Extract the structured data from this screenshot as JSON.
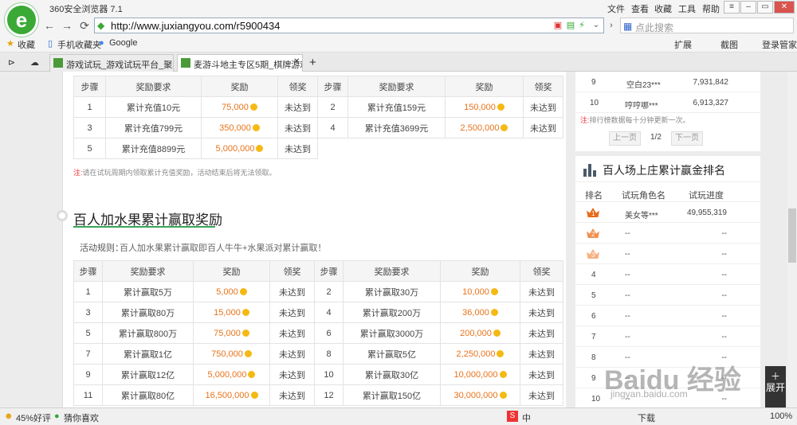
{
  "browser": {
    "app_title": "360安全浏览器 7.1",
    "menu": [
      "文件",
      "查看",
      "收藏",
      "工具",
      "帮助"
    ],
    "url": "http://www.juxiangyou.com/r5900434",
    "search_placeholder": "点此搜索",
    "toolbar": {
      "expand": "扩展",
      "screenshot": "截图",
      "login": "登录管家"
    },
    "bookmarks": [
      "收藏",
      "手机收藏夹",
      "Google"
    ],
    "tabs": [
      {
        "label": "游戏试玩_游戏试玩平台_聚享游",
        "active": false
      },
      {
        "label": "麦游斗地主专区5期_棋牌游戏",
        "active": true
      }
    ],
    "status": {
      "rating": "45%好评",
      "guess": "猜你喜欢",
      "download": "下载",
      "zoom": "100%",
      "ime": "中"
    }
  },
  "recharge_table": {
    "headers": [
      "步骤",
      "奖励要求",
      "奖励",
      "领奖",
      "步骤",
      "奖励要求",
      "奖励",
      "领奖"
    ],
    "rows": [
      [
        {
          "step": "1",
          "req": "累计充值10元",
          "reward": "75,000",
          "claim": "未达到"
        },
        {
          "step": "2",
          "req": "累计充值159元",
          "reward": "150,000",
          "claim": "未达到"
        }
      ],
      [
        {
          "step": "3",
          "req": "累计充值799元",
          "reward": "350,000",
          "claim": "未达到"
        },
        {
          "step": "4",
          "req": "累计充值3699元",
          "reward": "2,500,000",
          "claim": "未达到"
        }
      ],
      [
        {
          "step": "5",
          "req": "累计充值8899元",
          "reward": "5,000,000",
          "claim": "未达到"
        }
      ]
    ],
    "note_prefix": "注:",
    "note": "请在试玩周期内领取累计充值奖励，活动结束后将无法领取。"
  },
  "section": {
    "title": "百人加水果累计赢取奖励",
    "rules_label": "活动规则：",
    "rules": "百人加水果累计赢取即百人牛牛+水果派对累计赢取！"
  },
  "win_table": {
    "headers": [
      "步骤",
      "奖励要求",
      "奖励",
      "领奖",
      "步骤",
      "奖励要求",
      "奖励",
      "领奖"
    ],
    "rows": [
      [
        {
          "step": "1",
          "req": "累计赢取5万",
          "reward": "5,000",
          "claim": "未达到"
        },
        {
          "step": "2",
          "req": "累计赢取30万",
          "reward": "10,000",
          "claim": "未达到"
        }
      ],
      [
        {
          "step": "3",
          "req": "累计赢取80万",
          "reward": "15,000",
          "claim": "未达到"
        },
        {
          "step": "4",
          "req": "累计赢取200万",
          "reward": "36,000",
          "claim": "未达到"
        }
      ],
      [
        {
          "step": "5",
          "req": "累计赢取800万",
          "reward": "75,000",
          "claim": "未达到"
        },
        {
          "step": "6",
          "req": "累计赢取3000万",
          "reward": "200,000",
          "claim": "未达到"
        }
      ],
      [
        {
          "step": "7",
          "req": "累计赢取1亿",
          "reward": "750,000",
          "claim": "未达到"
        },
        {
          "step": "8",
          "req": "累计赢取5亿",
          "reward": "2,250,000",
          "claim": "未达到"
        }
      ],
      [
        {
          "step": "9",
          "req": "累计赢取12亿",
          "reward": "5,000,000",
          "claim": "未达到"
        },
        {
          "step": "10",
          "req": "累计赢取30亿",
          "reward": "10,000,000",
          "claim": "未达到"
        }
      ],
      [
        {
          "step": "11",
          "req": "累计赢取80亿",
          "reward": "16,500,000",
          "claim": "未达到"
        },
        {
          "step": "12",
          "req": "累计赢取150亿",
          "reward": "30,000,000",
          "claim": "未达到"
        }
      ]
    ]
  },
  "rank1": {
    "rows": [
      {
        "rank": "9",
        "name": "空白23***",
        "value": "7,931,842"
      },
      {
        "rank": "10",
        "name": "哼哼哪***",
        "value": "6,913,327"
      }
    ],
    "note_prefix": "注:",
    "note": "排行榜数据每十分钟更新一次。",
    "prev": "上一页",
    "page": "1/2",
    "next": "下一页"
  },
  "rank2": {
    "title": "百人场上庄累计赢金排名",
    "headers": [
      "排名",
      "试玩角色名",
      "试玩进度"
    ],
    "rows": [
      {
        "rank": "1",
        "name": "美女等***",
        "value": "49,955,319"
      },
      {
        "rank": "2",
        "name": "--",
        "value": "--"
      },
      {
        "rank": "3",
        "name": "--",
        "value": "--"
      },
      {
        "rank": "4",
        "name": "--",
        "value": "--"
      },
      {
        "rank": "5",
        "name": "--",
        "value": "--"
      },
      {
        "rank": "6",
        "name": "--",
        "value": "--"
      },
      {
        "rank": "7",
        "name": "--",
        "value": "--"
      },
      {
        "rank": "8",
        "name": "--",
        "value": "--"
      },
      {
        "rank": "9",
        "name": "--",
        "value": "--"
      },
      {
        "rank": "10",
        "name": "--",
        "value": "--"
      }
    ]
  },
  "expand_label": "展开",
  "watermark": {
    "main": "Baidu 经验",
    "sub": "jingyan.baidu.com"
  },
  "colors": {
    "accent": "#39a35b",
    "reward": "#e8731a",
    "crown1": "#e86a1a",
    "crown2": "#f09050",
    "crown3": "#f5b080"
  }
}
